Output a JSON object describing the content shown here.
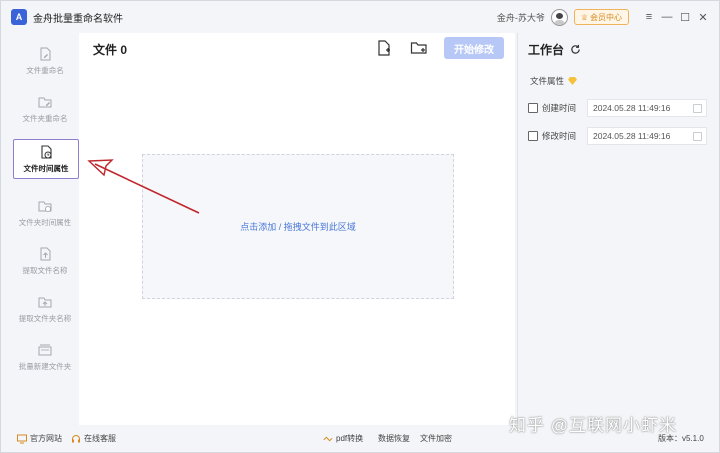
{
  "app": {
    "title": "金舟批量重命名软件",
    "logo_text": "A"
  },
  "user": {
    "name": "金舟-苏大爷"
  },
  "vip": {
    "label": "会员中心"
  },
  "window_controls": {
    "menu": "≡",
    "minimize": "—",
    "maximize": "☐",
    "close": "✕"
  },
  "sidebar": {
    "items": [
      {
        "label": "文件重命名"
      },
      {
        "label": "文件夹重命名"
      },
      {
        "label": "文件时间属性"
      },
      {
        "label": "文件夹时间属性"
      },
      {
        "label": "提取文件名称"
      },
      {
        "label": "提取文件夹名称"
      },
      {
        "label": "批量新建文件夹"
      }
    ],
    "active_index": 2
  },
  "main": {
    "title": "文件 0",
    "start_label": "开始修改",
    "dropzone_text": "点击添加 / 拖拽文件到此区域"
  },
  "workbench": {
    "title": "工作台",
    "section_label": "文件属性",
    "rows": [
      {
        "label": "创建时间",
        "value": "2024.05.28 11:49:16"
      },
      {
        "label": "修改时间",
        "value": "2024.05.28 11:49:16"
      }
    ]
  },
  "statusbar": {
    "official_site": "官方网站",
    "online_service": "在线客服",
    "pdf_convert": "pdf转换",
    "data_recovery": "数据恢复",
    "file_encrypt": "文件加密",
    "version": "版本：v5.1.0"
  },
  "watermark": "知乎 @互联网小虾米",
  "colors": {
    "accent": "#3a63d8",
    "start_button": "#b7c8f6",
    "arrow": "#c0272d",
    "active_border": "#8f7fd0"
  }
}
